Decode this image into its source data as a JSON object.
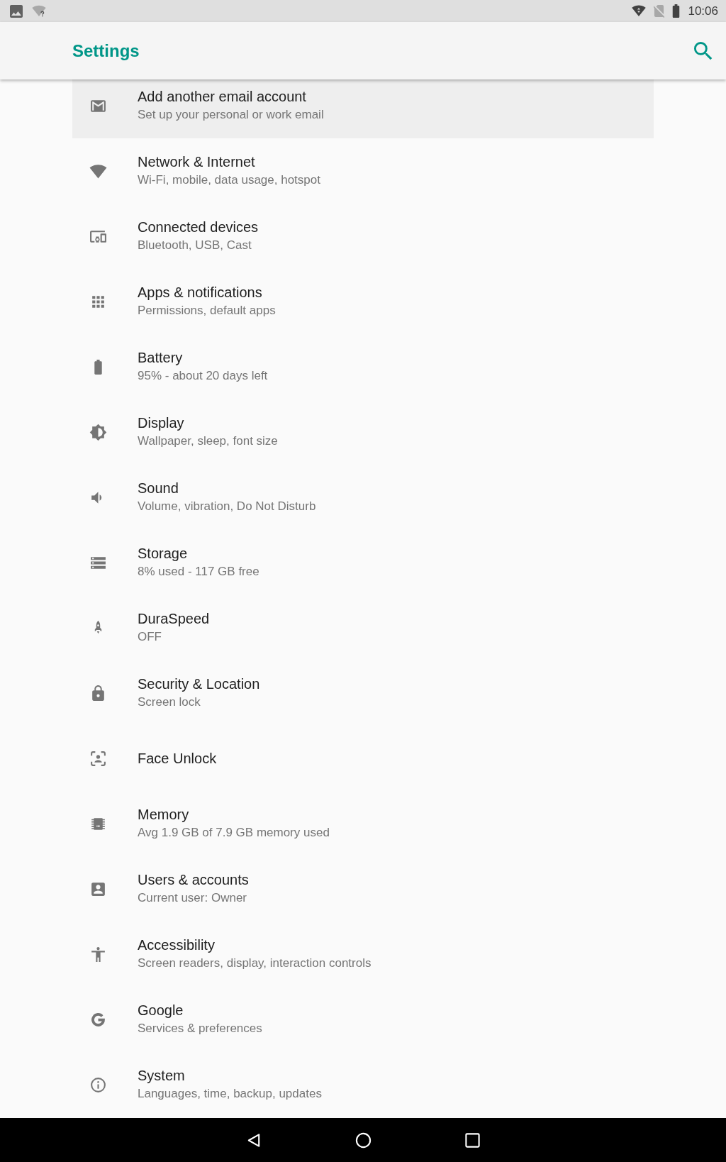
{
  "status_bar": {
    "time": "10:06"
  },
  "toolbar": {
    "title": "Settings"
  },
  "items": [
    {
      "title": "Add another email account",
      "subtitle": "Set up your personal or work email",
      "selected": true
    },
    {
      "title": "Network & Internet",
      "subtitle": "Wi-Fi, mobile, data usage, hotspot",
      "selected": false
    },
    {
      "title": "Connected devices",
      "subtitle": "Bluetooth, USB, Cast",
      "selected": false
    },
    {
      "title": "Apps & notifications",
      "subtitle": "Permissions, default apps",
      "selected": false
    },
    {
      "title": "Battery",
      "subtitle": "95% - about 20 days left",
      "selected": false
    },
    {
      "title": "Display",
      "subtitle": "Wallpaper, sleep, font size",
      "selected": false
    },
    {
      "title": "Sound",
      "subtitle": "Volume, vibration, Do Not Disturb",
      "selected": false
    },
    {
      "title": "Storage",
      "subtitle": "8% used - 117 GB free",
      "selected": false
    },
    {
      "title": "DuraSpeed",
      "subtitle": "OFF",
      "selected": false
    },
    {
      "title": "Security & Location",
      "subtitle": "Screen lock",
      "selected": false
    },
    {
      "title": "Face Unlock",
      "selected": false
    },
    {
      "title": "Memory",
      "subtitle": "Avg 1.9 GB of 7.9 GB memory used",
      "selected": false
    },
    {
      "title": "Users & accounts",
      "subtitle": "Current user: Owner",
      "selected": false
    },
    {
      "title": "Accessibility",
      "subtitle": "Screen readers, display, interaction controls",
      "selected": false
    },
    {
      "title": "Google",
      "subtitle": "Services & preferences",
      "selected": false
    },
    {
      "title": "System",
      "subtitle": "Languages, time, backup, updates",
      "selected": false
    }
  ]
}
